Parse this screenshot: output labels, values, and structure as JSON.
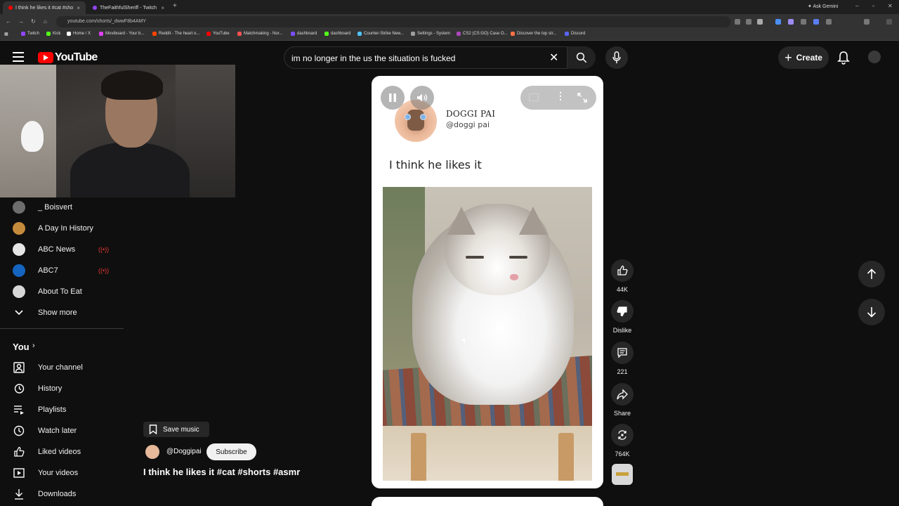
{
  "browser": {
    "tabs": [
      {
        "title": "I think he likes it #cat #sho",
        "active": true,
        "favicon_color": "#ff0000"
      },
      {
        "title": "TheFaithfulSheriff - Twitch",
        "active": false,
        "favicon_color": "#9146ff"
      }
    ],
    "new_tab": "+",
    "gemini": "Ask Gemini",
    "url": "youtube.com/shorts/_dwwF8b4AMY",
    "bookmarks": [
      {
        "label": "Twitch",
        "color": "#9146ff"
      },
      {
        "label": "Kick",
        "color": "#53fc18"
      },
      {
        "label": "Home / X",
        "color": "#ffffff"
      },
      {
        "label": "Moviboard - Your b...",
        "color": "#e040fb"
      },
      {
        "label": "Reddit - The heart o...",
        "color": "#ff4500"
      },
      {
        "label": "YouTube",
        "color": "#ff0000"
      },
      {
        "label": "Matchmaking - Nor...",
        "color": "#ff5252"
      },
      {
        "label": "dashboard",
        "color": "#7c4dff"
      },
      {
        "label": "dashboard",
        "color": "#53fc18"
      },
      {
        "label": "Counter-Strike New...",
        "color": "#4fc3f7"
      },
      {
        "label": "Settings - System",
        "color": "#9e9e9e"
      },
      {
        "label": "CS2 (CS:GO) Case O...",
        "color": "#ab47bc"
      },
      {
        "label": "Discover the top str...",
        "color": "#ff7043"
      },
      {
        "label": "Discord",
        "color": "#5865f2"
      }
    ]
  },
  "youtube": {
    "logo_text": "YouTube",
    "search_query": "im no longer in the us the situation is fucked",
    "create_label": "Create"
  },
  "sidebar": {
    "subscriptions": [
      {
        "label": "_ Boisvert",
        "avatar_color": "#6d6d6d",
        "live": false
      },
      {
        "label": "A Day In History",
        "avatar_color": "#c58b3c",
        "live": false
      },
      {
        "label": "ABC News",
        "avatar_color": "#e6e6e6",
        "live": true
      },
      {
        "label": "ABC7",
        "avatar_color": "#1565c0",
        "live": true
      },
      {
        "label": "About To Eat",
        "avatar_color": "#d7d7d7",
        "live": false
      }
    ],
    "show_more": "Show more",
    "you_heading": "You",
    "you_items": [
      {
        "label": "Your channel",
        "icon": "channel-icon"
      },
      {
        "label": "History",
        "icon": "history-icon"
      },
      {
        "label": "Playlists",
        "icon": "playlists-icon"
      },
      {
        "label": "Watch later",
        "icon": "watch-later-icon"
      },
      {
        "label": "Liked videos",
        "icon": "liked-icon"
      },
      {
        "label": "Your videos",
        "icon": "your-videos-icon"
      },
      {
        "label": "Downloads",
        "icon": "downloads-icon"
      }
    ]
  },
  "short": {
    "creator_name": "DOGGI PAI",
    "creator_handle": "@doggi pai",
    "caption": "I think he likes it"
  },
  "actions": {
    "like_count": "44K",
    "dislike_label": "Dislike",
    "comment_count": "221",
    "share_label": "Share",
    "remix_count": "764K"
  },
  "video_info": {
    "save_music": "Save music",
    "channel": "@Doggipai",
    "subscribe": "Subscribe",
    "title": "I think he likes it #cat #shorts #asmr"
  }
}
